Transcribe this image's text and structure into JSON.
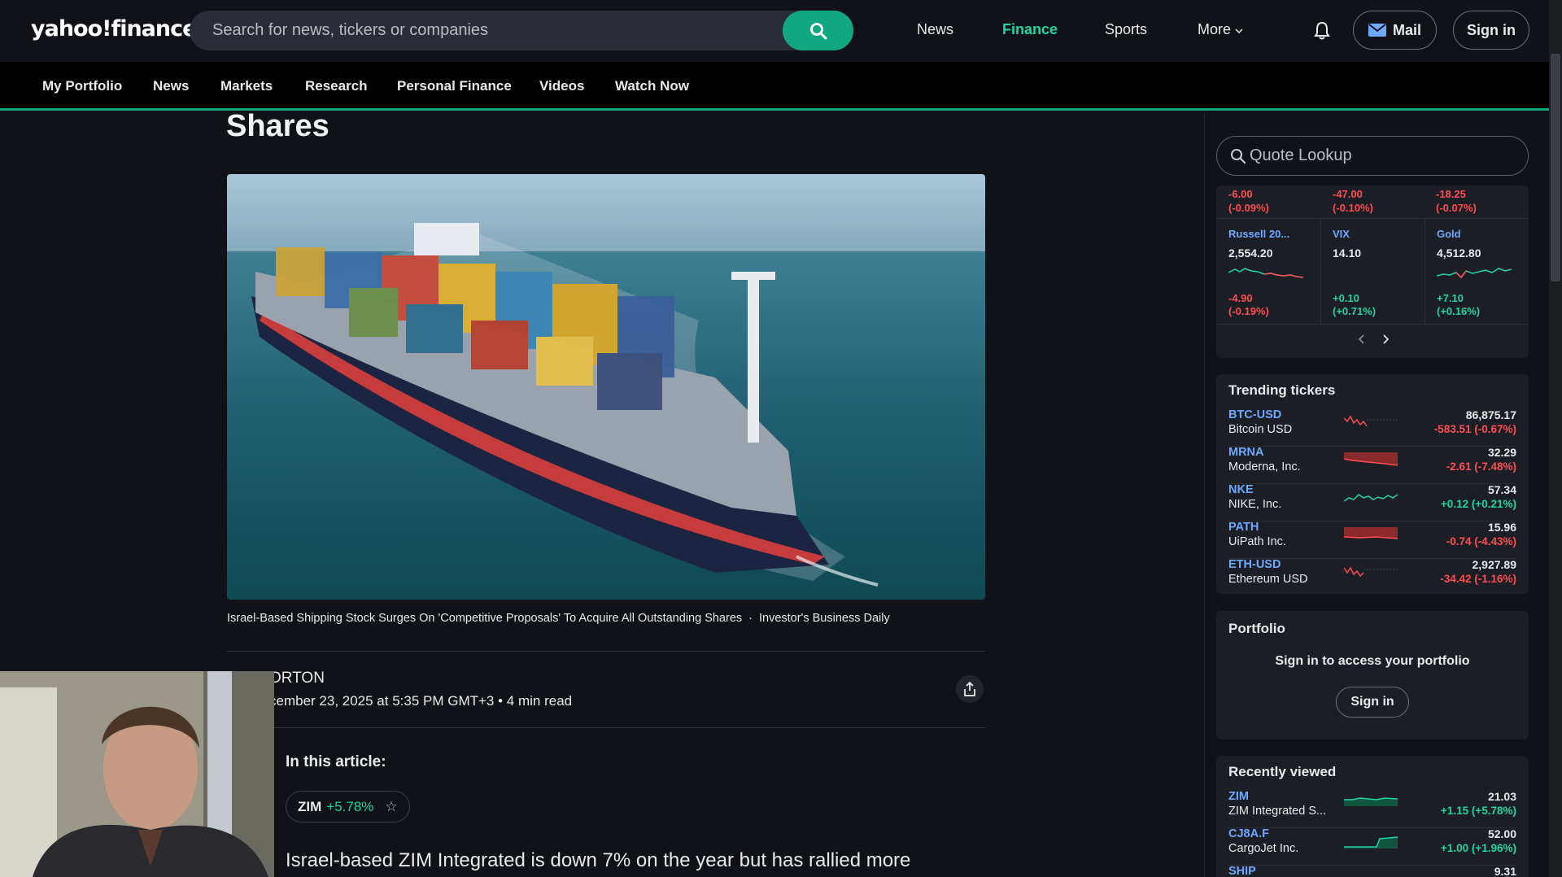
{
  "header": {
    "logo": "yahoo!finance",
    "search_placeholder": "Search for news, tickers or companies",
    "nav": [
      "News",
      "Finance",
      "Sports",
      "More"
    ],
    "mail": "Mail",
    "sign_in": "Sign in"
  },
  "subnav": [
    "My Portfolio",
    "News",
    "Markets",
    "Research",
    "Personal Finance",
    "Videos",
    "Watch Now"
  ],
  "article": {
    "title": "Shares",
    "caption": "Israel-Based Shipping Stock Surges On 'Competitive Proposals' To Acquire All Outstanding Shares",
    "source": "Investor's Business Daily",
    "author": "ORTON",
    "dateline": "cember 23, 2025 at 5:35 PM GMT+3 • 4 min read",
    "in_this_article": "In this article:",
    "ticker": {
      "symbol": "ZIM",
      "change": "+5.78%"
    },
    "lead": "Israel-based ZIM Integrated is down 7% on the year but has rallied more"
  },
  "sidebar": {
    "quote_placeholder": "Quote Lookup",
    "markets_top": [
      {
        "change": "-6.00",
        "pct": "(-0.09%)"
      },
      {
        "change": "-47.00",
        "pct": "(-0.10%)"
      },
      {
        "change": "-18.25",
        "pct": "(-0.07%)"
      }
    ],
    "markets": [
      {
        "name": "Russell 20...",
        "price": "2,554.20",
        "change": "-4.90",
        "pct": "(-0.19%)",
        "dir": "down"
      },
      {
        "name": "VIX",
        "price": "14.10",
        "change": "+0.10",
        "pct": "(+0.71%)",
        "dir": "up"
      },
      {
        "name": "Gold",
        "price": "4,512.80",
        "change": "+7.10",
        "pct": "(+0.16%)",
        "dir": "up"
      }
    ],
    "trending_title": "Trending tickers",
    "trending": [
      {
        "symbol": "BTC-USD",
        "name": "Bitcoin USD",
        "price": "86,875.17",
        "change": "-583.51 (-0.67%)",
        "dir": "down"
      },
      {
        "symbol": "MRNA",
        "name": "Moderna, Inc.",
        "price": "32.29",
        "change": "-2.61 (-7.48%)",
        "dir": "down"
      },
      {
        "symbol": "NKE",
        "name": "NIKE, Inc.",
        "price": "57.34",
        "change": "+0.12 (+0.21%)",
        "dir": "up"
      },
      {
        "symbol": "PATH",
        "name": "UiPath Inc.",
        "price": "15.96",
        "change": "-0.74 (-4.43%)",
        "dir": "down"
      },
      {
        "symbol": "ETH-USD",
        "name": "Ethereum USD",
        "price": "2,927.89",
        "change": "-34.42 (-1.16%)",
        "dir": "down"
      }
    ],
    "portfolio_title": "Portfolio",
    "portfolio_msg": "Sign in to access your portfolio",
    "portfolio_btn": "Sign in",
    "recent_title": "Recently viewed",
    "recent": [
      {
        "symbol": "ZIM",
        "name": "ZIM Integrated S...",
        "price": "21.03",
        "change": "+1.15 (+5.78%)",
        "dir": "up"
      },
      {
        "symbol": "CJ8A.F",
        "name": "CargoJet Inc.",
        "price": "52.00",
        "change": "+1.00 (+1.96%)",
        "dir": "up"
      },
      {
        "symbol": "SHIP",
        "name": "",
        "price": "9.31",
        "change": "",
        "dir": "up"
      }
    ]
  },
  "colors": {
    "accent": "#12a87f",
    "up": "#1ed69e",
    "down": "#ff4d52",
    "link": "#6fa8ff",
    "bg": "#101217"
  }
}
